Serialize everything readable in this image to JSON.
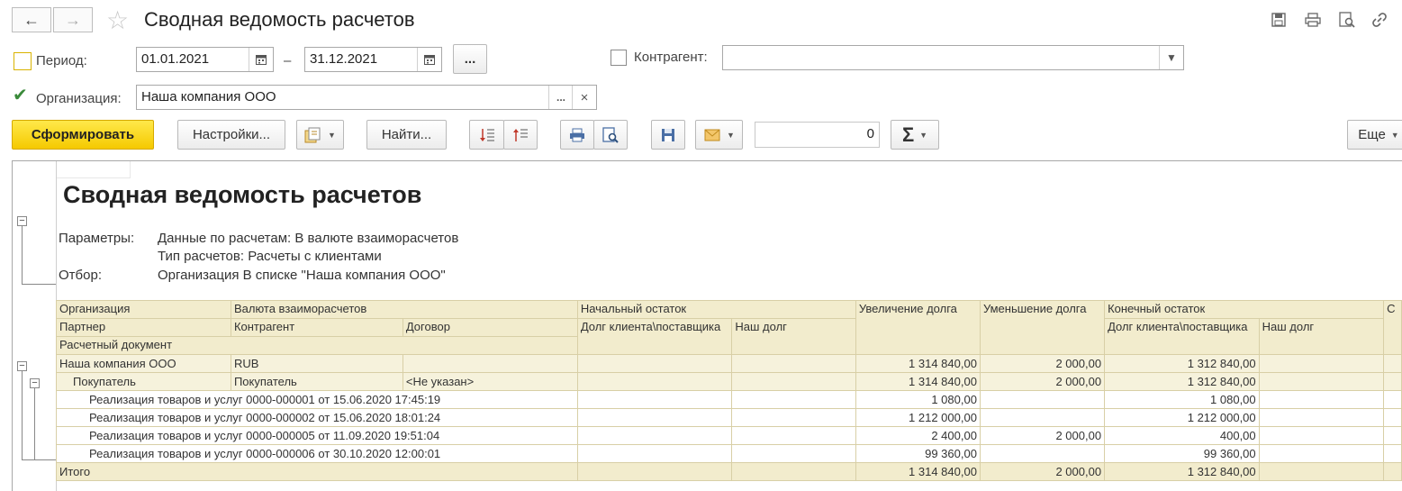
{
  "window": {
    "title": "Сводная ведомость расчетов"
  },
  "filters": {
    "period_label": "Период:",
    "date_from": "01.01.2021",
    "date_dash": "–",
    "date_to": "31.12.2021",
    "period_btn": "...",
    "contractor_label": "Контрагент:",
    "contractor_value": "",
    "org_label": "Организация:",
    "org_value": "Наша компания ООО",
    "org_select_btn": "...",
    "org_clear_btn": "×"
  },
  "toolbar": {
    "generate": "Сформировать",
    "settings": "Настройки...",
    "find": "Найти...",
    "sum_value": "0",
    "more": "Еще"
  },
  "report": {
    "title": "Сводная ведомость расчетов",
    "params_label": "Параметры:",
    "params_line1": "Данные по расчетам: В валюте взаиморасчетов",
    "params_line2": "Тип расчетов: Расчеты с клиентами",
    "filter_label": "Отбор:",
    "filter_value": "Организация В списке \"Наша компания ООО\"",
    "headers": {
      "org": "Организация",
      "currency": "Валюта взаиморасчетов",
      "opening": "Начальный остаток",
      "increase": "Увеличение долга",
      "decrease": "Уменьшение долга",
      "closing": "Конечный остаток",
      "partner": "Партнер",
      "contractor": "Контрагент",
      "contract": "Договор",
      "client_debt": "Долг клиента\\поставщика",
      "our_debt": "Наш долг",
      "document": "Расчетный документ"
    },
    "rows": [
      {
        "c1": "Наша компания ООО",
        "c2": "RUB",
        "c3": "",
        "open_client": "",
        "open_our": "",
        "inc": "1 314 840,00",
        "dec": "2 000,00",
        "close_client": "1 312 840,00",
        "close_our": ""
      },
      {
        "c1": "Покупатель",
        "c2": "Покупатель",
        "c3": "<Не указан>",
        "open_client": "",
        "open_our": "",
        "inc": "1 314 840,00",
        "dec": "2 000,00",
        "close_client": "1 312 840,00",
        "close_our": ""
      },
      {
        "c1": "Реализация товаров и услуг 0000-000001 от 15.06.2020 17:45:19",
        "inc": "1 080,00",
        "dec": "",
        "close_client": "1 080,00"
      },
      {
        "c1": "Реализация товаров и услуг 0000-000002 от 15.06.2020 18:01:24",
        "inc": "1 212 000,00",
        "dec": "",
        "close_client": "1 212 000,00"
      },
      {
        "c1": "Реализация товаров и услуг 0000-000005 от 11.09.2020 19:51:04",
        "inc": "2 400,00",
        "dec": "2 000,00",
        "close_client": "400,00"
      },
      {
        "c1": "Реализация товаров и услуг 0000-000006 от 30.10.2020 12:00:01",
        "inc": "99 360,00",
        "dec": "",
        "close_client": "99 360,00"
      }
    ],
    "total": {
      "label": "Итого",
      "inc": "1 314 840,00",
      "dec": "2 000,00",
      "close_client": "1 312 840,00"
    }
  },
  "colors": {
    "accent": "#f5c900",
    "header_bg": "#f2eccd",
    "check": "#3a8a3a"
  }
}
